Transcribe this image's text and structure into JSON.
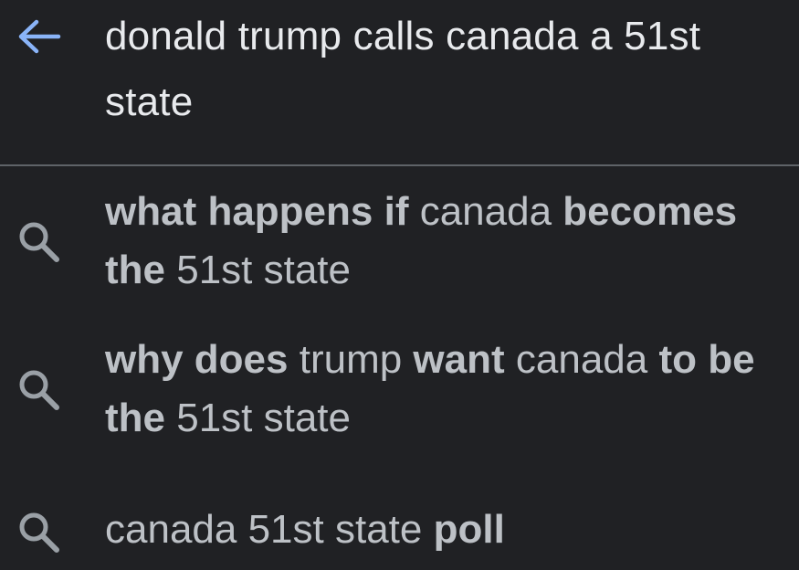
{
  "header": {
    "back_icon": "arrow-left-icon",
    "query": "donald trump calls canada a 51st state",
    "accent_color": "#8ab4f8"
  },
  "suggestions": [
    {
      "icon": "search-icon",
      "segments": [
        {
          "text": "what happens if",
          "bold": true
        },
        {
          "text": " canada ",
          "bold": false
        },
        {
          "text": "becomes the",
          "bold": true
        },
        {
          "text": " 51st state",
          "bold": false
        }
      ]
    },
    {
      "icon": "search-icon",
      "segments": [
        {
          "text": "why does",
          "bold": true
        },
        {
          "text": " trump ",
          "bold": false
        },
        {
          "text": "want",
          "bold": true
        },
        {
          "text": " canada ",
          "bold": false
        },
        {
          "text": "to be the",
          "bold": true
        },
        {
          "text": " 51st state",
          "bold": false
        }
      ]
    },
    {
      "icon": "search-icon",
      "segments": [
        {
          "text": "canada 51st state ",
          "bold": false
        },
        {
          "text": "poll",
          "bold": true
        }
      ]
    }
  ]
}
